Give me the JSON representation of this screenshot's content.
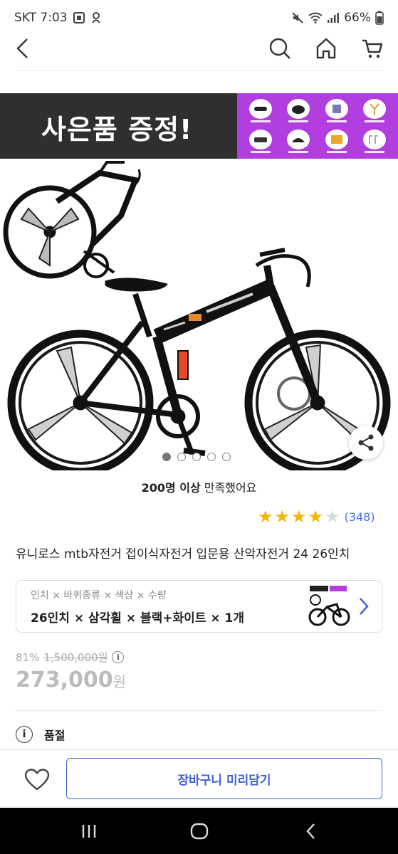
{
  "status_bar": {
    "carrier_time": "SKT 7:03",
    "battery": "66%"
  },
  "header": {
    "back_icon": "chevron-left-icon",
    "search_icon": "search-icon",
    "home_icon": "home-icon",
    "cart_icon": "cart-icon"
  },
  "hero": {
    "banner_text": "사은품 증정!",
    "slide_count": 5,
    "active_slide": 1,
    "share_icon": "share-icon",
    "colors": {
      "banner_bg": "#2f2f2f",
      "gift_panel_bg": "#b23ee0"
    }
  },
  "satisfaction": {
    "count_text": "200명 이상",
    "suffix": " 만족했어요"
  },
  "rating": {
    "stars": 4,
    "max_stars": 5,
    "count": "(348)"
  },
  "product": {
    "title": "유니로스 mtb자전거 접이식자전거 입문용 산악자전거 24 26인치"
  },
  "option": {
    "labels": "인치 × 바퀴종류 × 색상 × 수량",
    "values": "26인치 × 삼각휠 × 블랙+화이트 × 1개",
    "chevron_icon": "chevron-right-icon"
  },
  "price": {
    "discount": "81%",
    "original": "1,500,000원",
    "sale": "273,000",
    "won": "원"
  },
  "stock": {
    "status": "품절",
    "icon": "info-icon"
  },
  "actions": {
    "wishlist_icon": "heart-icon",
    "cart_label": "장바구니 미리담기"
  },
  "navigation": {
    "recents_icon": "recents-icon",
    "home_icon": "home-circle-icon",
    "back_icon": "back-icon"
  }
}
